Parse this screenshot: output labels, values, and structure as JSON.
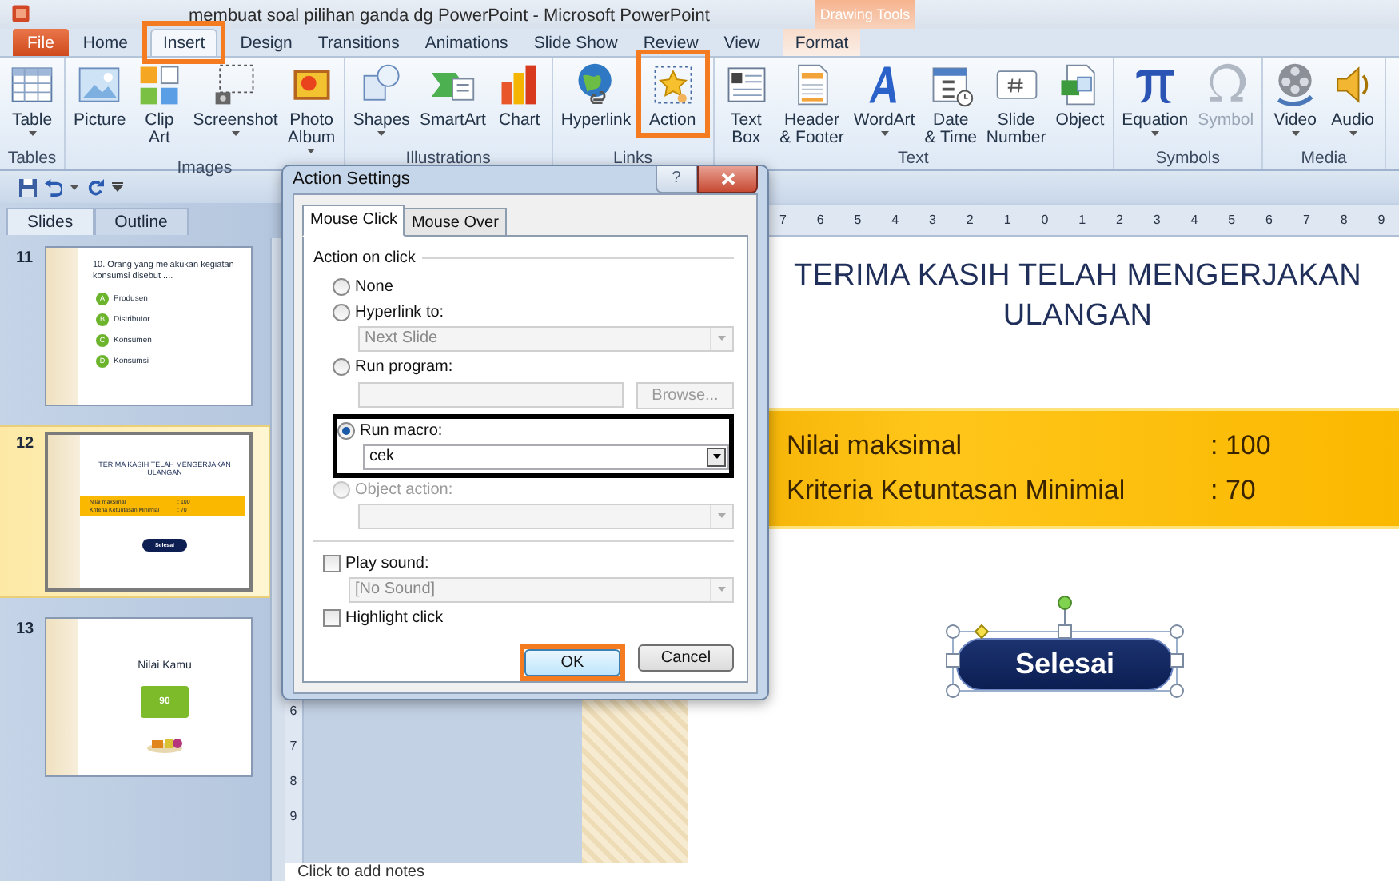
{
  "window": {
    "title": "membuat soal pilihan ganda dg PowerPoint - Microsoft PowerPoint"
  },
  "contextual_group": {
    "label": "Drawing Tools"
  },
  "tabs": [
    {
      "label": "File",
      "kind": "file",
      "selected": false,
      "highlighted": false
    },
    {
      "label": "Home",
      "kind": "tab",
      "selected": false,
      "highlighted": false
    },
    {
      "label": "Insert",
      "kind": "tab",
      "selected": true,
      "highlighted": true
    },
    {
      "label": "Design",
      "kind": "tab",
      "selected": false,
      "highlighted": false
    },
    {
      "label": "Transitions",
      "kind": "tab",
      "selected": false,
      "highlighted": false
    },
    {
      "label": "Animations",
      "kind": "tab",
      "selected": false,
      "highlighted": false
    },
    {
      "label": "Slide Show",
      "kind": "tab",
      "selected": false,
      "highlighted": false
    },
    {
      "label": "Review",
      "kind": "tab",
      "selected": false,
      "highlighted": false
    },
    {
      "label": "View",
      "kind": "tab",
      "selected": false,
      "highlighted": false
    },
    {
      "label": "Format",
      "kind": "contextual",
      "selected": false,
      "highlighted": false
    }
  ],
  "ribbon_groups": [
    {
      "label": "Tables",
      "buttons": [
        {
          "label": "Table",
          "dropdown": true,
          "disabled": false,
          "highlighted": false
        }
      ]
    },
    {
      "label": "Images",
      "buttons": [
        {
          "label": "Picture",
          "dropdown": false,
          "disabled": false,
          "highlighted": false
        },
        {
          "label": "Clip\nArt",
          "dropdown": false,
          "disabled": false,
          "highlighted": false
        },
        {
          "label": "Screenshot",
          "dropdown": true,
          "disabled": false,
          "highlighted": false
        },
        {
          "label": "Photo\nAlbum",
          "dropdown": true,
          "disabled": false,
          "highlighted": false
        }
      ]
    },
    {
      "label": "Illustrations",
      "buttons": [
        {
          "label": "Shapes",
          "dropdown": true,
          "disabled": false,
          "highlighted": false
        },
        {
          "label": "SmartArt",
          "dropdown": false,
          "disabled": false,
          "highlighted": false
        },
        {
          "label": "Chart",
          "dropdown": false,
          "disabled": false,
          "highlighted": false
        }
      ]
    },
    {
      "label": "Links",
      "buttons": [
        {
          "label": "Hyperlink",
          "dropdown": false,
          "disabled": false,
          "highlighted": false
        },
        {
          "label": "Action",
          "dropdown": false,
          "disabled": false,
          "highlighted": true
        }
      ]
    },
    {
      "label": "Text",
      "buttons": [
        {
          "label": "Text\nBox",
          "dropdown": false,
          "disabled": false,
          "highlighted": false
        },
        {
          "label": "Header\n& Footer",
          "dropdown": false,
          "disabled": false,
          "highlighted": false
        },
        {
          "label": "WordArt",
          "dropdown": true,
          "disabled": false,
          "highlighted": false
        },
        {
          "label": "Date\n& Time",
          "dropdown": false,
          "disabled": false,
          "highlighted": false
        },
        {
          "label": "Slide\nNumber",
          "dropdown": false,
          "disabled": false,
          "highlighted": false
        },
        {
          "label": "Object",
          "dropdown": false,
          "disabled": false,
          "highlighted": false
        }
      ]
    },
    {
      "label": "Symbols",
      "buttons": [
        {
          "label": "Equation",
          "dropdown": true,
          "disabled": false,
          "highlighted": false
        },
        {
          "label": "Symbol",
          "dropdown": false,
          "disabled": true,
          "highlighted": false
        }
      ]
    },
    {
      "label": "Media",
      "buttons": [
        {
          "label": "Video",
          "dropdown": true,
          "disabled": false,
          "highlighted": false
        },
        {
          "label": "Audio",
          "dropdown": true,
          "disabled": false,
          "highlighted": false
        }
      ]
    }
  ],
  "slides_pane": {
    "tabs": [
      {
        "label": "Slides",
        "selected": true
      },
      {
        "label": "Outline",
        "selected": false
      }
    ],
    "slides": [
      {
        "number": "11",
        "kind": "question",
        "selected": false,
        "question": "10. Orang yang melakukan kegiatan konsumsi disebut ....",
        "options": [
          {
            "letter": "A",
            "text": "Produsen"
          },
          {
            "letter": "B",
            "text": "Distributor"
          },
          {
            "letter": "C",
            "text": "Konsumen"
          },
          {
            "letter": "D",
            "text": "Konsumsi"
          }
        ]
      },
      {
        "number": "12",
        "kind": "result",
        "selected": true,
        "title": "TERIMA KASIH TELAH MENGERJAKAN ULANGAN",
        "rows": [
          {
            "label": "Nilai maksimal",
            "value": ": 100"
          },
          {
            "label": "Kriteria Ketuntasan Minimial",
            "value": ": 70"
          }
        ],
        "button": "Selesai"
      },
      {
        "number": "13",
        "kind": "score",
        "selected": false,
        "title": "Nilai Kamu",
        "score": "90"
      }
    ]
  },
  "rulers": {
    "horizontal": [
      "7",
      "6",
      "5",
      "4",
      "3",
      "2",
      "1",
      "0",
      "1",
      "2",
      "3",
      "4",
      "5",
      "6",
      "7",
      "8",
      "9"
    ],
    "vertical": [
      "6",
      "7",
      "8",
      "9"
    ]
  },
  "slide": {
    "title": "TERIMA KASIH TELAH MENGERJAKAN ULANGAN",
    "rows": [
      {
        "label": "Nilai maksimal",
        "value": ": 100"
      },
      {
        "label": "Kriteria Ketuntasan Minimial",
        "value": ": 70"
      }
    ],
    "button": {
      "label": "Selesai",
      "selected": true
    }
  },
  "notes": {
    "placeholder": "Click to add notes"
  },
  "dialog": {
    "title": "Action Settings",
    "help": "?",
    "tabs": [
      {
        "label": "Mouse Click",
        "selected": true
      },
      {
        "label": "Mouse Over",
        "selected": false
      }
    ],
    "group_label": "Action on click",
    "actions": [
      {
        "label": "None",
        "selected": false,
        "disabled": false,
        "highlighted": false
      },
      {
        "label": "Hyperlink to:",
        "selected": false,
        "disabled": false,
        "highlighted": false,
        "select": {
          "value": "Next Slide",
          "disabled": true
        }
      },
      {
        "label": "Run program:",
        "selected": false,
        "disabled": false,
        "highlighted": false,
        "field": {
          "disabled": true
        },
        "browse": {
          "label": "Browse...",
          "disabled": true
        }
      },
      {
        "label": "Run macro:",
        "selected": true,
        "disabled": false,
        "highlighted": true,
        "select": {
          "value": "cek",
          "disabled": false
        }
      },
      {
        "label": "Object action:",
        "selected": false,
        "disabled": true,
        "highlighted": false,
        "select": {
          "disabled": true
        }
      }
    ],
    "options": [
      {
        "label": "Play sound:",
        "checked": false,
        "select": {
          "value": "[No Sound]",
          "disabled": true
        }
      },
      {
        "label": "Highlight click",
        "checked": false
      }
    ],
    "buttons": [
      {
        "label": "OK",
        "kind": "default",
        "highlighted": true
      },
      {
        "label": "Cancel",
        "kind": "normal",
        "highlighted": false
      }
    ]
  }
}
